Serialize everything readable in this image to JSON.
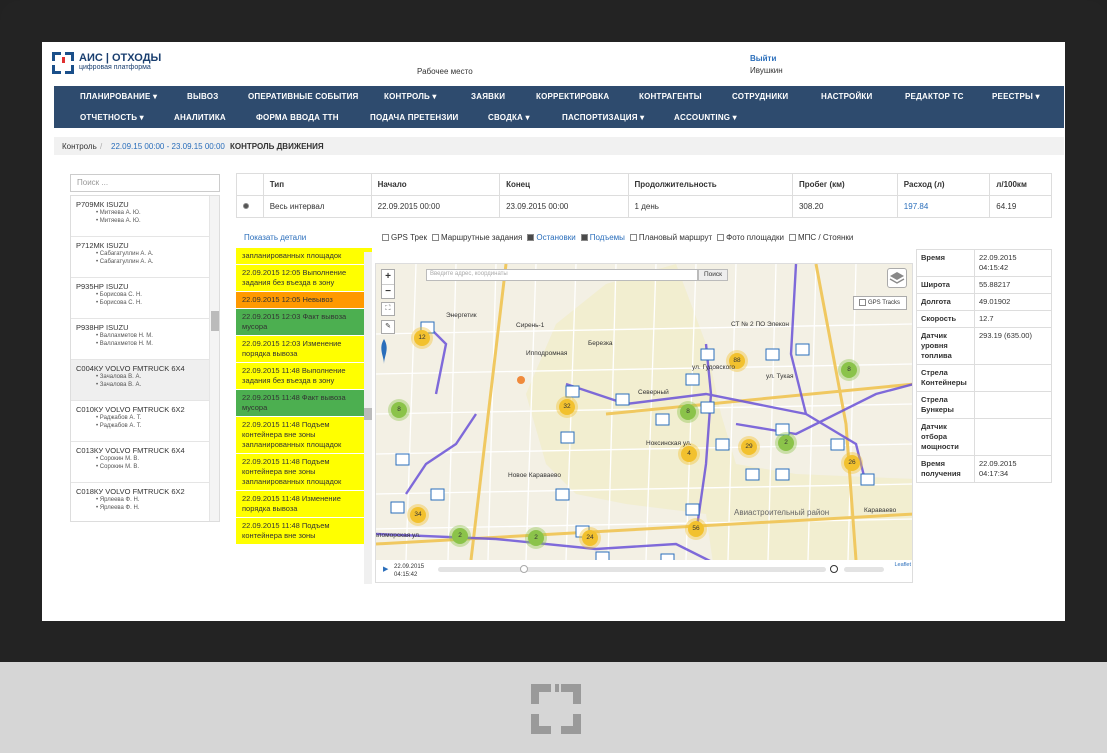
{
  "colors": {
    "navbar": "#2e4b6e",
    "link": "#2a6ebb",
    "event_yellow": "#ffff00",
    "event_orange": "#ff9900",
    "event_green": "#4caf50",
    "cluster": "#f2c12e",
    "cluster_green": "#8bc34a",
    "track": "#6a52d8"
  },
  "header": {
    "logo_title": "АИС | ОТХОДЫ",
    "logo_subtitle": "цифровая платформа",
    "workplace": "Рабочее место",
    "logout": "Выйти",
    "username": "Ивушкин"
  },
  "nav": {
    "row1": [
      "ПЛАНИРОВАНИЕ ▾",
      "ВЫВОЗ",
      "ОПЕРАТИВНЫЕ СОБЫТИЯ",
      "КОНТРОЛЬ ▾",
      "ЗАЯВКИ",
      "КОРРЕКТИРОВКА",
      "КОНТРАГЕНТЫ",
      "СОТРУДНИКИ",
      "НАСТРОЙКИ",
      "РЕДАКТОР ТС",
      "РЕЕСТРЫ ▾"
    ],
    "row2": [
      "ОТЧЕТНОСТЬ ▾",
      "АНАЛИТИКА",
      "ФОРМА ВВОДА ТТН",
      "ПОДАЧА ПРЕТЕНЗИИ",
      "СВОДКА ▾",
      "ПАСПОРТИЗАЦИЯ ▾",
      "ACCOUNTING ▾"
    ]
  },
  "breadcrumb": {
    "root": "Контроль",
    "sep": "/",
    "range": "22.09.15 00:00 - 23.09.15 00:00",
    "current": "КОНТРОЛЬ ДВИЖЕНИЯ"
  },
  "search": {
    "placeholder": "Поиск ..."
  },
  "vehicles": [
    {
      "name": "Р709МК ISUZU",
      "drivers": [
        "Митяева А. Ю.",
        "Митяева А. Ю."
      ]
    },
    {
      "name": "Р712МК ISUZU",
      "drivers": [
        "Сабагатуллин А. А.",
        "Сабагатуллин А. А."
      ]
    },
    {
      "name": "Р935НР ISUZU",
      "drivers": [
        "Борисова С. Н.",
        "Борисова С. Н."
      ]
    },
    {
      "name": "Р938НР ISUZU",
      "drivers": [
        "Валлахметов Н. М.",
        "Валлахметов Н. М."
      ]
    },
    {
      "name": "С004КУ VOLVO FMTRUCK 6Х4",
      "drivers": [
        "Зачалова В. А.",
        "Зачалова В. А."
      ]
    },
    {
      "name": "С010КУ VOLVO FMTRUCK 6Х2",
      "drivers": [
        "Раджабов А. Т.",
        "Раджабов А. Т."
      ]
    },
    {
      "name": "С013КУ VOLVO FMTRUCK 6Х4",
      "drivers": [
        "Сорокин М. В.",
        "Сорокин М. В."
      ]
    },
    {
      "name": "С018КУ VOLVO FMTRUCK 6Х2",
      "drivers": [
        "Ярлеева Ф. Н.",
        "Ярлеева Ф. Н."
      ]
    }
  ],
  "summary": {
    "headers": [
      "Тип",
      "Начало",
      "Конец",
      "Продолжительность",
      "Пробег (км)",
      "Расход (л)",
      "л/100км"
    ],
    "row": [
      "Весь интервал",
      "22.09.2015 00:00",
      "23.09.2015 00:00",
      "1 день",
      "308.20",
      "197.84",
      "64.19"
    ]
  },
  "show_details": "Показать детали",
  "filters": [
    {
      "label": "GPS Трек",
      "checked": false
    },
    {
      "label": "Маршрутные задания",
      "checked": false
    },
    {
      "label": "Остановки",
      "checked": true
    },
    {
      "label": "Подъемы",
      "checked": true
    },
    {
      "label": "Плановый маршрут",
      "checked": false
    },
    {
      "label": "Фото площадки",
      "checked": false
    },
    {
      "label": "МПС / Стоянки",
      "checked": false
    }
  ],
  "events": [
    {
      "text": "запланированных площадок",
      "color": "y"
    },
    {
      "text": "22.09.2015 12:05 Выполнение задания без въезда в зону",
      "color": "y"
    },
    {
      "text": "22.09.2015 12:05 Невывоз",
      "color": "o"
    },
    {
      "text": "22.09.2015 12:03 Факт вывоза мусора",
      "color": "g"
    },
    {
      "text": "22.09.2015 12:03 Изменение порядка вывоза",
      "color": "y"
    },
    {
      "text": "22.09.2015 11:48 Выполнение задания без въезда в зону",
      "color": "y"
    },
    {
      "text": "22.09.2015 11:48 Факт вывоза мусора",
      "color": "g"
    },
    {
      "text": "22.09.2015 11:48 Подъем контейнера вне зоны запланированных площадок",
      "color": "y"
    },
    {
      "text": "22.09.2015 11:48 Подъем контейнера вне зоны запланированных площадок",
      "color": "y"
    },
    {
      "text": "22.09.2015 11:48 Изменение порядка вывоза",
      "color": "y"
    },
    {
      "text": "22.09.2015 11:48 Подъем контейнера вне зоны",
      "color": "y"
    }
  ],
  "map": {
    "search_placeholder": "Введите адрес, координаты",
    "search_button": "Поиск",
    "gps_tracks": "GPS Tracks",
    "timeline_date": "22.09.2015",
    "timeline_time": "04:15:42",
    "attribution": "Leaflet",
    "zoom_in": "+",
    "zoom_out": "−",
    "labels": [
      "Энергетик",
      "Сирень-1",
      "СТ № 2 ПО Элекон",
      "Березка",
      "Северный",
      "Новое Караваево",
      "Авиастроительный район",
      "Караваево",
      "Беломорская ул.",
      "Ипподромная",
      "ул. Тукая",
      "ул. Гудовского",
      "Ноксинская ул."
    ],
    "clusters": [
      {
        "count": "12",
        "color": "y"
      },
      {
        "count": "88",
        "color": "y"
      },
      {
        "count": "32",
        "color": "y"
      },
      {
        "count": "8",
        "color": "g"
      },
      {
        "count": "8",
        "color": "g"
      },
      {
        "count": "29",
        "color": "y"
      },
      {
        "count": "2",
        "color": "g"
      },
      {
        "count": "26",
        "color": "y"
      },
      {
        "count": "34",
        "color": "y"
      },
      {
        "count": "2",
        "color": "g"
      },
      {
        "count": "24",
        "color": "y"
      },
      {
        "count": "56",
        "color": "y"
      },
      {
        "count": "8",
        "color": "g"
      },
      {
        "count": "4",
        "color": "y"
      },
      {
        "count": "2",
        "color": "g"
      }
    ]
  },
  "details": [
    {
      "k": "Время",
      "v": "22.09.2015 04:15:42"
    },
    {
      "k": "Широта",
      "v": "55.88217"
    },
    {
      "k": "Долгота",
      "v": "49.01902"
    },
    {
      "k": "Скорость",
      "v": "12.7"
    },
    {
      "k": "Датчик уровня топлива",
      "v": "293.19 (635.00)"
    },
    {
      "k": "Стрела Контейнеры",
      "v": ""
    },
    {
      "k": "Стрела Бункеры",
      "v": ""
    },
    {
      "k": "Датчик отбора мощности",
      "v": ""
    },
    {
      "k": "Время получения",
      "v": "22.09.2015 04:17:34"
    }
  ]
}
